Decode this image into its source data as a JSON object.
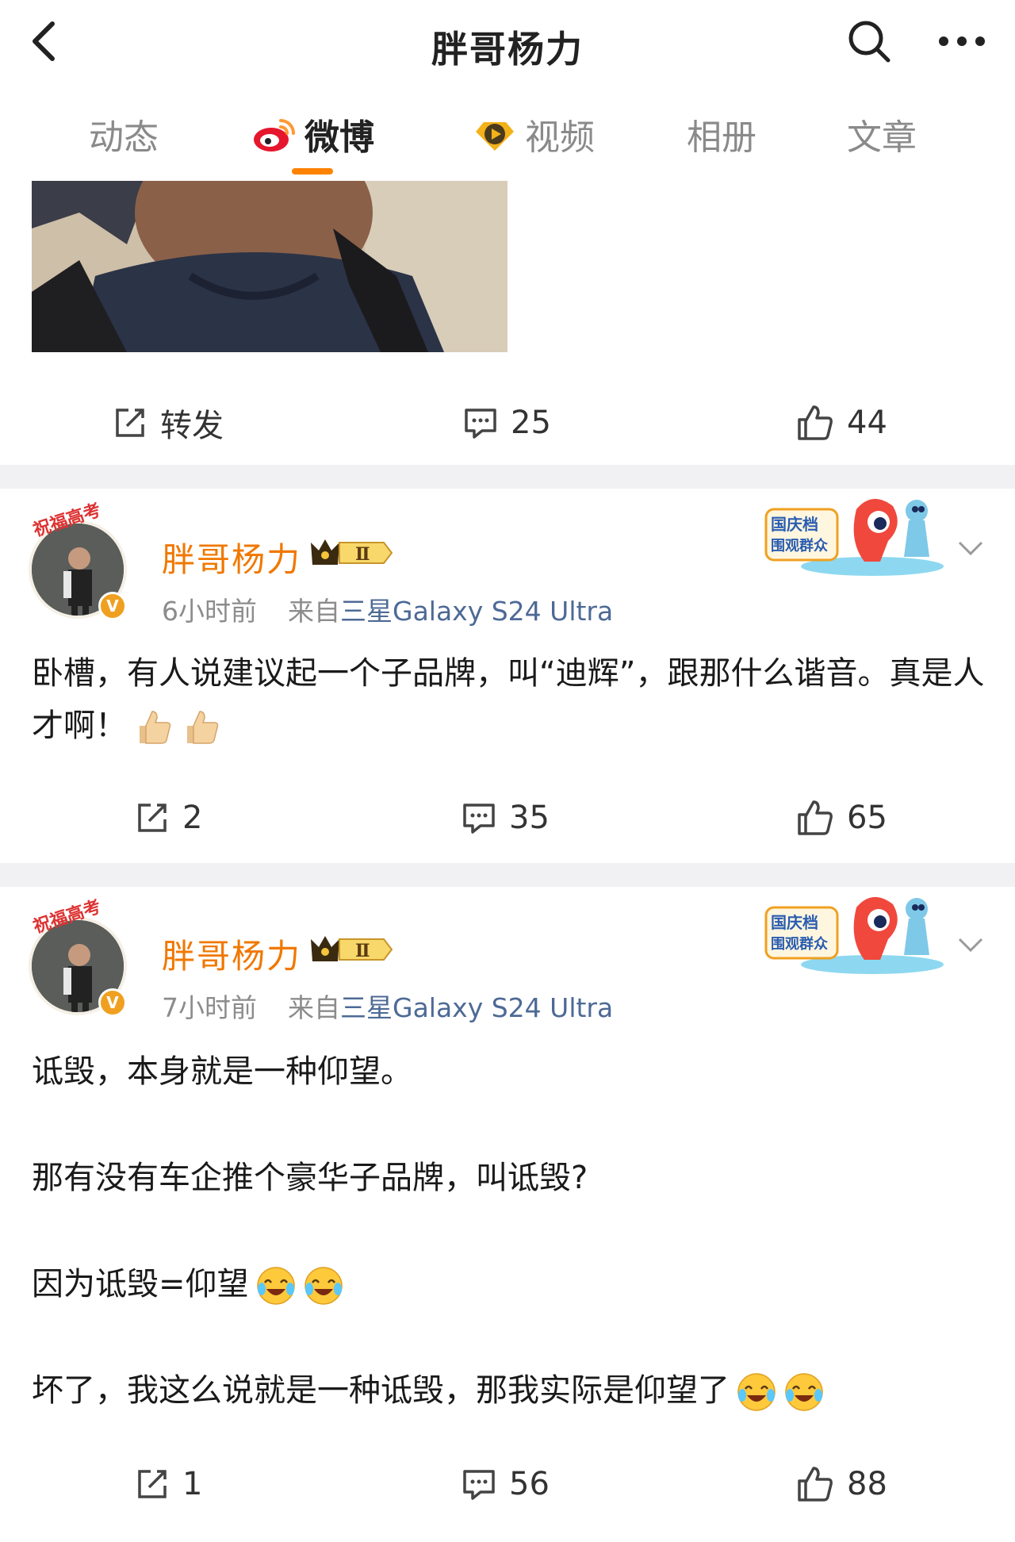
{
  "header": {
    "title": "胖哥杨力",
    "back_icon": "chevron-left-icon",
    "search_icon": "search-icon",
    "more_icon": "more-horizontal-icon"
  },
  "tabs": [
    {
      "label": "动态",
      "active": false
    },
    {
      "label": "微博",
      "active": true,
      "icon": "weibo-logo-icon"
    },
    {
      "label": "视频",
      "active": false,
      "icon": "video-badge-icon"
    },
    {
      "label": "相册",
      "active": false
    },
    {
      "label": "文章",
      "active": false
    }
  ],
  "accent_color": "#ff8200",
  "top_post_actions": {
    "repost": "转发",
    "comments": "25",
    "likes": "44"
  },
  "posts": [
    {
      "username": "胖哥杨力",
      "avatar_frame_text": "祝福高考",
      "vip_badge": "Ⅱ",
      "time": "6小时前",
      "source_prefix": "来自",
      "device": "三星Galaxy S24 Ultra",
      "sticker_text_1": "国庆档",
      "sticker_text_2": "围观群众",
      "paragraphs": [
        "卧槽，有人说建议起一个子品牌，叫“迪辉”，跟那什么谐音。真是人才啊！"
      ],
      "emojis": [
        "thumbs-up-icon",
        "thumbs-up-icon"
      ],
      "reposts": "2",
      "comments": "35",
      "likes": "65"
    },
    {
      "username": "胖哥杨力",
      "avatar_frame_text": "祝福高考",
      "vip_badge": "Ⅱ",
      "time": "7小时前",
      "source_prefix": "来自",
      "device": "三星Galaxy S24 Ultra",
      "sticker_text_1": "国庆档",
      "sticker_text_2": "围观群众",
      "paragraphs": [
        "诋毁，本身就是一种仰望。",
        "",
        "那有没有车企推个豪华子品牌，叫诋毁?",
        "",
        "因为诋毁=仰望",
        "",
        "坏了，我这么说就是一种诋毁，那我实际是仰望了"
      ],
      "reposts": "1",
      "comments": "56",
      "likes": "88"
    }
  ]
}
